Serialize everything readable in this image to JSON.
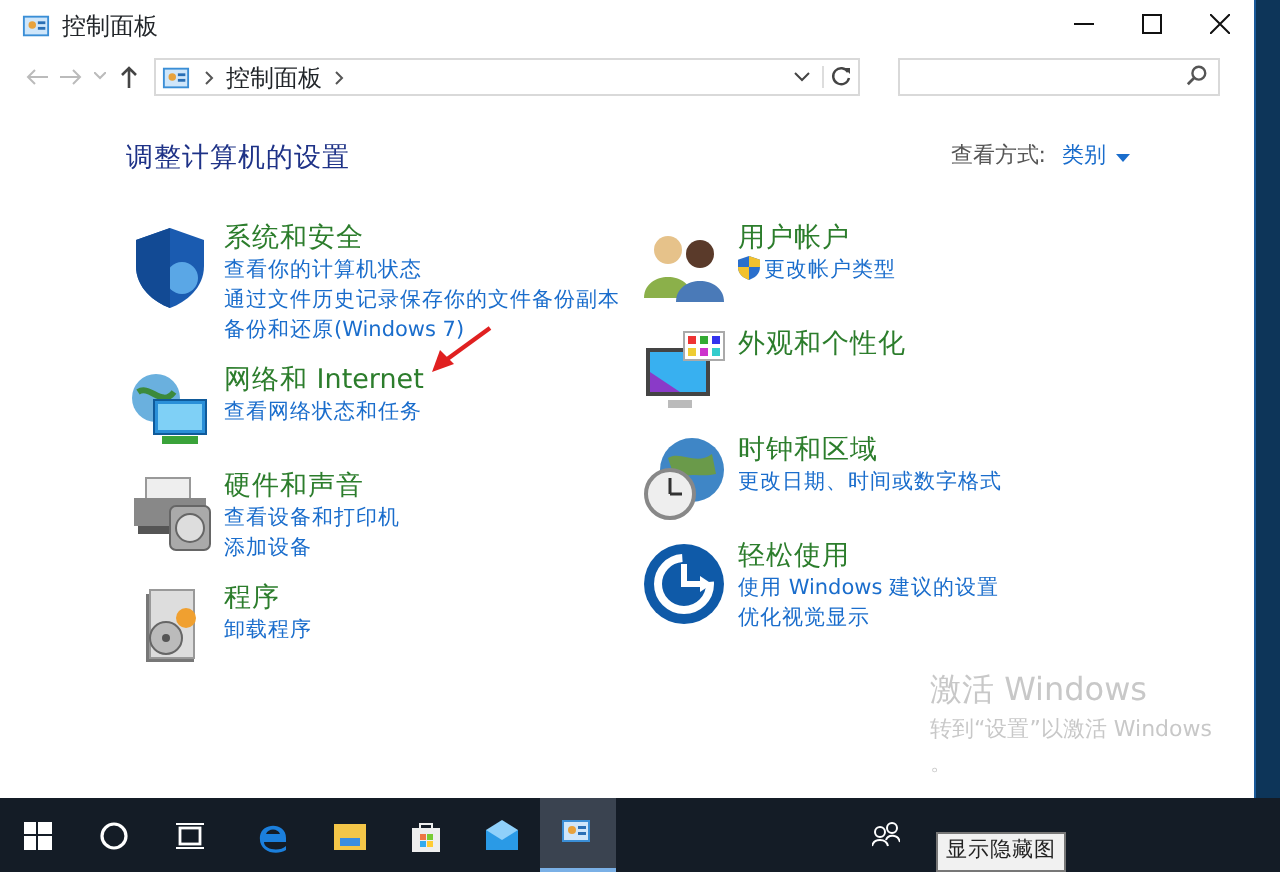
{
  "window": {
    "title": "控制面板"
  },
  "address_bar": {
    "crumbs": [
      "控制面板"
    ]
  },
  "heading": "调整计算机的设置",
  "view_by": {
    "label": "查看方式:",
    "value": "类别"
  },
  "columns": [
    [
      {
        "title": "系统和安全",
        "links": [
          {
            "text": "查看你的计算机状态",
            "kind": "plain"
          },
          {
            "text": "通过文件历史记录保存你的文件备份副本",
            "kind": "plain"
          },
          {
            "text": "备份和还原(Windows 7)",
            "kind": "plain"
          }
        ]
      },
      {
        "title": "网络和 Internet",
        "links": [
          {
            "text": "查看网络状态和任务",
            "kind": "plain"
          }
        ]
      },
      {
        "title": "硬件和声音",
        "links": [
          {
            "text": "查看设备和打印机",
            "kind": "plain"
          },
          {
            "text": "添加设备",
            "kind": "plain"
          }
        ]
      },
      {
        "title": "程序",
        "links": [
          {
            "text": "卸载程序",
            "kind": "plain"
          }
        ]
      }
    ],
    [
      {
        "title": "用户帐户",
        "links": [
          {
            "text": "更改帐户类型",
            "kind": "admin"
          }
        ]
      },
      {
        "title": "外观和个性化"
      },
      {
        "title": "时钟和区域",
        "links": [
          {
            "text": "更改日期、时间或数字格式",
            "kind": "plain"
          }
        ]
      },
      {
        "title": "轻松使用",
        "links": [
          {
            "text": "使用 Windows 建议的设置",
            "kind": "plain"
          },
          {
            "text": "优化视觉显示",
            "kind": "plain"
          }
        ]
      }
    ]
  ],
  "activation": {
    "title": "激活 Windows",
    "subtitle": "转到“设置”以激活 Windows",
    "mark": "。"
  },
  "taskbar": {
    "apps": [
      {
        "selected": false
      },
      {
        "selected": false
      },
      {
        "selected": false
      },
      {
        "selected": false
      },
      {
        "selected": true
      }
    ],
    "tooltip": "显示隐藏图"
  }
}
